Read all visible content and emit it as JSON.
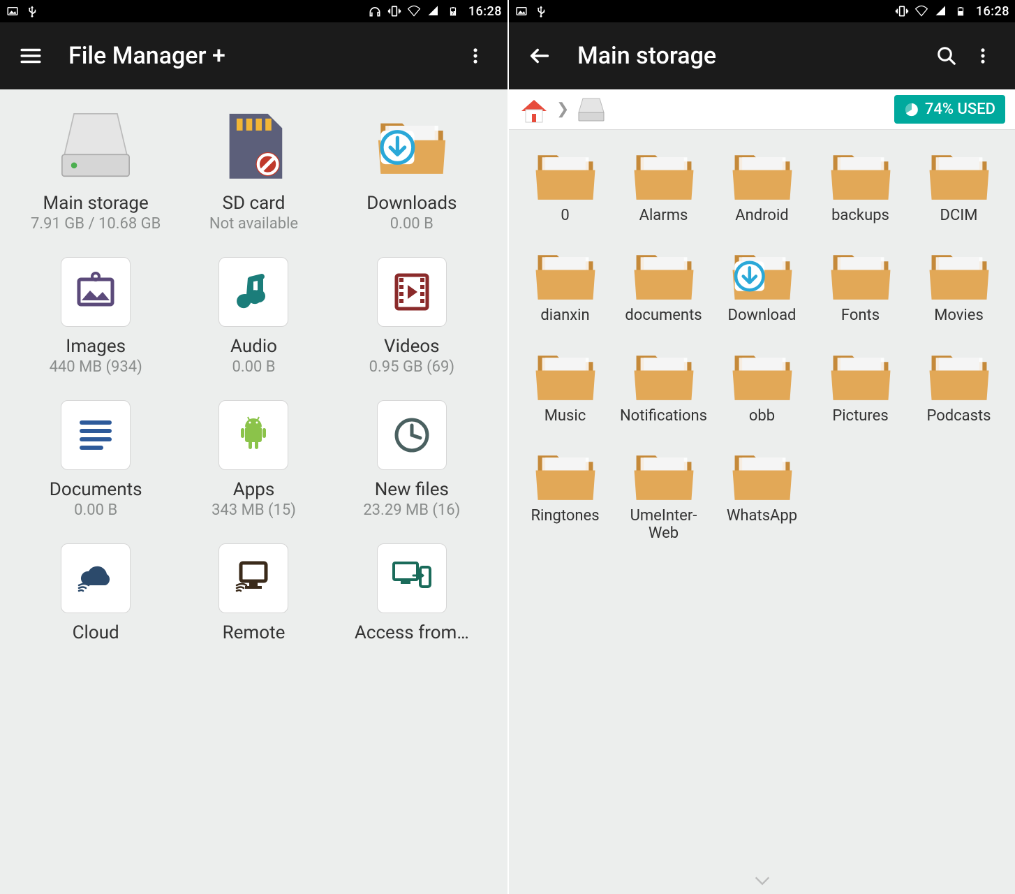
{
  "statusbar": {
    "clock": "16:28"
  },
  "screen1": {
    "title": "File Manager +",
    "items": [
      {
        "id": "main-storage",
        "label": "Main storage",
        "sublabel": "7.91 GB / 10.68 GB",
        "icon": "drive"
      },
      {
        "id": "sd-card",
        "label": "SD card",
        "sublabel": "Not available",
        "icon": "sdcard"
      },
      {
        "id": "downloads",
        "label": "Downloads",
        "sublabel": "0.00 B",
        "icon": "download-folder"
      },
      {
        "id": "images",
        "label": "Images",
        "sublabel": "440 MB (934)",
        "icon": "images",
        "card": true
      },
      {
        "id": "audio",
        "label": "Audio",
        "sublabel": "0.00 B",
        "icon": "audio",
        "card": true
      },
      {
        "id": "videos",
        "label": "Videos",
        "sublabel": "0.95 GB (69)",
        "icon": "videos",
        "card": true
      },
      {
        "id": "documents",
        "label": "Documents",
        "sublabel": "0.00 B",
        "icon": "documents",
        "card": true
      },
      {
        "id": "apps",
        "label": "Apps",
        "sublabel": "343 MB (15)",
        "icon": "apps",
        "card": true
      },
      {
        "id": "new-files",
        "label": "New files",
        "sublabel": "23.29 MB (16)",
        "icon": "newfiles",
        "card": true
      },
      {
        "id": "cloud",
        "label": "Cloud",
        "sublabel": "",
        "icon": "cloud",
        "card": true
      },
      {
        "id": "remote",
        "label": "Remote",
        "sublabel": "",
        "icon": "remote",
        "card": true
      },
      {
        "id": "access-from",
        "label": "Access from…",
        "sublabel": "",
        "icon": "access",
        "card": true
      }
    ]
  },
  "screen2": {
    "title": "Main storage",
    "usage_label": "74% USED",
    "usage_percent": 74,
    "folders": [
      {
        "label": "0"
      },
      {
        "label": "Alarms"
      },
      {
        "label": "Android"
      },
      {
        "label": "backups"
      },
      {
        "label": "DCIM"
      },
      {
        "label": "dianxin"
      },
      {
        "label": "docu­ments"
      },
      {
        "label": "Download",
        "overlay": "download"
      },
      {
        "label": "Fonts"
      },
      {
        "label": "Movies"
      },
      {
        "label": "Music"
      },
      {
        "label": "Notifica­tions"
      },
      {
        "label": "obb"
      },
      {
        "label": "Pictures"
      },
      {
        "label": "Podcasts"
      },
      {
        "label": "Ringtones"
      },
      {
        "label": "UmeInter­Web"
      },
      {
        "label": "WhatsApp"
      }
    ]
  }
}
